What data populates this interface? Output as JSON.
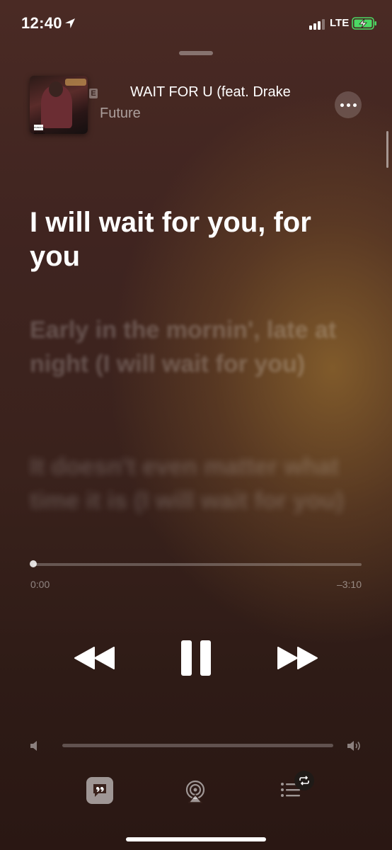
{
  "status_bar": {
    "time": "12:40",
    "network": "LTE",
    "battery_color": "#4cd964"
  },
  "now_playing": {
    "explicit_badge": "E",
    "title": "WAIT FOR U (feat. Drake",
    "artist": "Future",
    "album_art_badge": "PARENTAL ADVISORY"
  },
  "lyrics": {
    "current": "I will wait for you, for you",
    "next": "Early in the mornin', late at night (I will wait for you)",
    "after": "It doesn't even matter what time it is (I will wait for you)"
  },
  "playback": {
    "elapsed": "0:00",
    "remaining": "–3:10",
    "progress": 0.0,
    "volume": 0.0
  },
  "icons": {
    "location": "location-arrow-icon",
    "more": "ellipsis-icon",
    "rewind": "rewind-icon",
    "pause": "pause-icon",
    "forward": "fast-forward-icon",
    "lyrics": "lyrics-quote-icon",
    "airplay": "airplay-audio-icon",
    "queue": "queue-list-icon",
    "repeat": "repeat-icon"
  }
}
